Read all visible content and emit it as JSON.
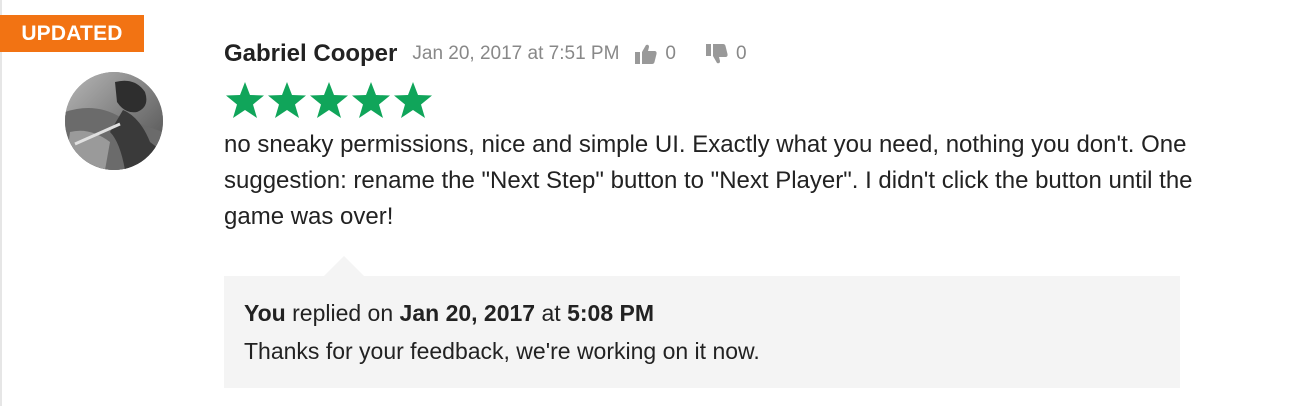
{
  "badge": {
    "label": "UPDATED",
    "color": "#f27313"
  },
  "review": {
    "author": "Gabriel Cooper",
    "timestamp": "Jan 20, 2017 at 7:51 PM",
    "thumbs_up_count": "0",
    "thumbs_down_count": "0",
    "rating": 5,
    "max_rating": 5,
    "star_color": "#10a55a",
    "text": "no sneaky permissions, nice and simple UI. Exactly what you need, nothing you don't. One suggestion: rename the \"Next Step\" button to \"Next Player\". I didn't click the button until the game was over!"
  },
  "reply": {
    "who": "You",
    "verb": " replied on ",
    "date": "Jan 20, 2017",
    "at": " at ",
    "time": "5:08 PM",
    "text": "Thanks for your feedback, we're working on it now."
  },
  "icons": {
    "thumbs_up": "thumbs-up-icon",
    "thumbs_down": "thumbs-down-icon",
    "star": "star-icon"
  }
}
